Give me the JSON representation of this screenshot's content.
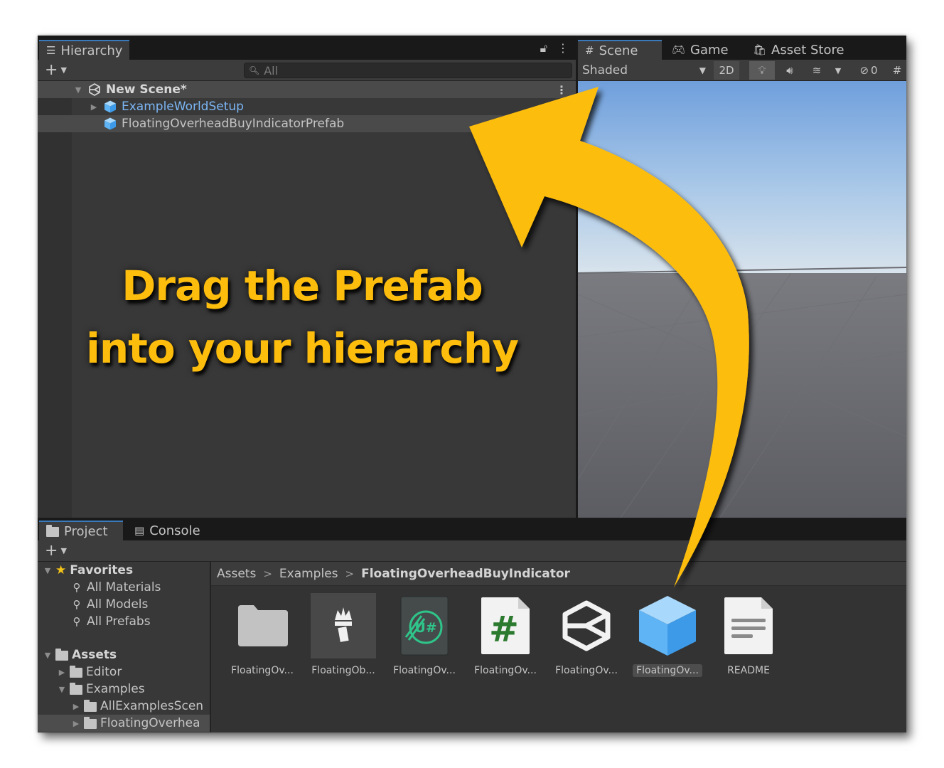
{
  "hierarchy": {
    "tab_label": "Hierarchy",
    "search_placeholder": "All",
    "scene_name": "New Scene*",
    "items": [
      {
        "label": "ExampleWorldSetup"
      },
      {
        "label": "FloatingOverheadBuyIndicatorPrefab"
      }
    ]
  },
  "scene": {
    "tabs": [
      {
        "label": "Scene"
      },
      {
        "label": "Game"
      },
      {
        "label": "Asset Store"
      }
    ],
    "draw_mode": "Shaded",
    "mode_2d": "2D",
    "hidden_count": "0"
  },
  "project": {
    "tabs": [
      {
        "label": "Project"
      },
      {
        "label": "Console"
      }
    ],
    "sidebar": {
      "favorites_label": "Favorites",
      "favorites": [
        {
          "label": "All Materials"
        },
        {
          "label": "All Models"
        },
        {
          "label": "All Prefabs"
        }
      ],
      "assets_label": "Assets",
      "folders": [
        {
          "label": "Editor"
        },
        {
          "label": "Examples"
        },
        {
          "label": "AllExamplesScen"
        },
        {
          "label": "FloatingOverhea"
        }
      ]
    },
    "breadcrumb": [
      "Assets",
      "Examples",
      "FloatingOverheadBuyIndicator"
    ],
    "assets": [
      {
        "label": "FloatingOv...",
        "icon": "folder-icon"
      },
      {
        "label": "FloatingOb...",
        "icon": "crown-logo-icon"
      },
      {
        "label": "FloatingOv...",
        "icon": "udon-sharp-icon"
      },
      {
        "label": "FloatingOv...",
        "icon": "csharp-script-icon"
      },
      {
        "label": "FloatingOv...",
        "icon": "unity-scene-icon"
      },
      {
        "label": "FloatingOv...",
        "icon": "prefab-cube-icon"
      },
      {
        "label": "README",
        "icon": "text-document-icon"
      }
    ]
  },
  "callout": {
    "line1": "Drag the Prefab",
    "line2": "into your hierarchy",
    "color": "#fdbd0d"
  },
  "colors": {
    "accent_blue": "#7cb6f5",
    "prefab_cube": "#5fb4f5",
    "arrow_yellow": "#fdbd0d"
  }
}
